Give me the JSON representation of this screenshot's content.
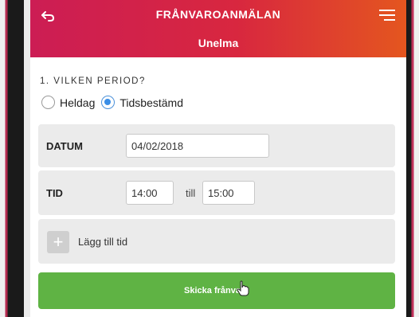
{
  "header": {
    "title": "FRÅNVAROANMÄLAN",
    "subtitle": "Unelma"
  },
  "period": {
    "question": "1. VILKEN PERIOD?",
    "options": [
      {
        "label": "Heldag",
        "selected": false
      },
      {
        "label": "Tidsbestämd",
        "selected": true
      }
    ]
  },
  "datum": {
    "label": "DATUM",
    "value": "04/02/2018"
  },
  "tid": {
    "label": "TID",
    "from": "14:00",
    "separator": "till",
    "to": "15:00"
  },
  "add_time": {
    "icon": "+",
    "label": "Lägg till tid"
  },
  "submit": {
    "label": "Skicka frånvaro"
  },
  "colors": {
    "header_start": "#cc1d54",
    "header_end": "#e4561f",
    "submit": "#5fb344",
    "radio_selected": "#3a8ee6"
  }
}
